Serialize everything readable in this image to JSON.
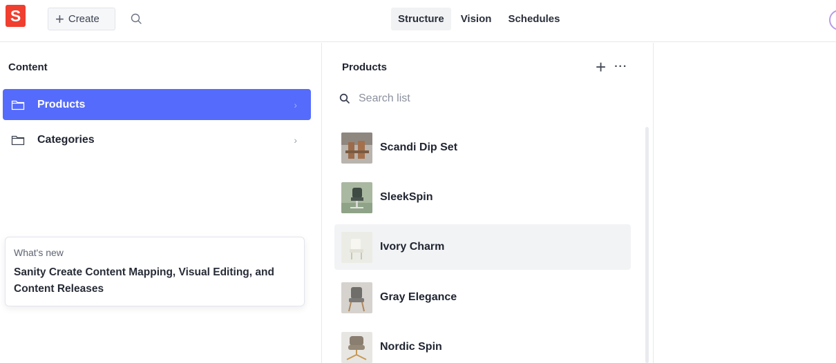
{
  "topbar": {
    "logo_text": "S",
    "create_label": "Create",
    "tabs": [
      {
        "label": "Structure",
        "active": true
      },
      {
        "label": "Vision",
        "active": false
      },
      {
        "label": "Schedules",
        "active": false
      }
    ]
  },
  "content_pane": {
    "title": "Content",
    "items": [
      {
        "label": "Products",
        "selected": true,
        "icon": "folder-icon"
      },
      {
        "label": "Categories",
        "selected": false,
        "icon": "folder-icon"
      }
    ],
    "whats_new": {
      "label": "What's new",
      "title": "Sanity Create Content Mapping, Visual Editing, and Content Releases"
    }
  },
  "products_pane": {
    "title": "Products",
    "search_placeholder": "Search list",
    "items": [
      {
        "name": "Scandi Dip Set"
      },
      {
        "name": "SleekSpin"
      },
      {
        "name": "Ivory Charm"
      },
      {
        "name": "Gray Elegance"
      },
      {
        "name": "Nordic Spin"
      }
    ]
  },
  "colors": {
    "brand": "#f03e2f",
    "selected": "#556bfc",
    "avatar_ring": "#b79be8"
  }
}
